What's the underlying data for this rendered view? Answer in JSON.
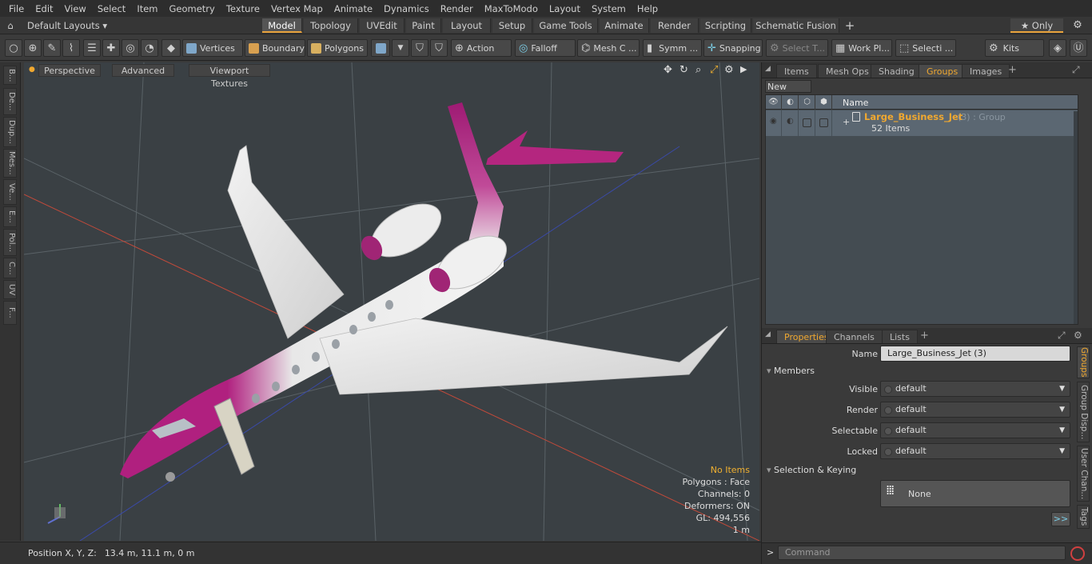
{
  "menubar": {
    "items": [
      "File",
      "Edit",
      "View",
      "Select",
      "Item",
      "Geometry",
      "Texture",
      "Vertex Map",
      "Animate",
      "Dynamics",
      "Render",
      "MaxToModo",
      "Layout",
      "System",
      "Help"
    ]
  },
  "layoutbar": {
    "layout_selector": "Default Layouts ▾",
    "tabs": [
      "Model",
      "Topology",
      "UVEdit",
      "Paint",
      "Layout",
      "Setup",
      "Game Tools",
      "Animate",
      "Render",
      "Scripting",
      "Schematic Fusion"
    ],
    "active_tab": "Model",
    "add_label": "+",
    "only_label": "★  Only",
    "gear_label": "⚙"
  },
  "toolbar": {
    "vertices": "Vertices",
    "boundary": "Boundary",
    "polygons": "Polygons",
    "action": "Action",
    "falloff": "Falloff",
    "mesh": "Mesh C ...",
    "symm": "Symm ...",
    "snapping": "Snapping",
    "select_t": "Select T...",
    "workplane": "Work Pl...",
    "selecti": "Selecti ...",
    "kits": "Kits"
  },
  "lefttabs": [
    "B...",
    "De...",
    "Dup...",
    "Mes...",
    "Ve...",
    "E...",
    "Pol...",
    "C...",
    "UV",
    "F..."
  ],
  "viewport": {
    "tabs": [
      "Perspective",
      "Advanced",
      "Viewport Textures"
    ],
    "info": {
      "no_items": "No Items",
      "polygons": "Polygons : Face",
      "channels": "Channels: 0",
      "deformers": "Deformers: ON",
      "gl": "GL: 494,556",
      "scale": "1 m"
    }
  },
  "statusbar": {
    "position_label": "Position X, Y, Z:",
    "position_value": "13.4 m, 11.1 m, 0 m"
  },
  "groups_panel": {
    "tabs": [
      "Items",
      "Mesh Ops",
      "Shading",
      "Groups",
      "Images"
    ],
    "active_tab": "Groups",
    "new_group": "New Group",
    "col_name": "Name",
    "row": {
      "name": "Large_Business_Jet",
      "suffix": "(3) : Group",
      "count": "52 Items"
    }
  },
  "properties": {
    "tabs": [
      "Properties",
      "Channels",
      "Lists"
    ],
    "active_tab": "Properties",
    "name_label": "Name",
    "name_value": "Large_Business_Jet (3)",
    "members_section": "Members",
    "visible_label": "Visible",
    "visible_value": "default",
    "render_label": "Render",
    "render_value": "default",
    "selectable_label": "Selectable",
    "selectable_value": "default",
    "locked_label": "Locked",
    "locked_value": "default",
    "selkey_section": "Selection & Keying",
    "none_label": "None",
    "more_label": ">>",
    "side_tabs": [
      "Groups",
      "Group Disp...",
      "User Chan...",
      "Tags"
    ]
  },
  "command": {
    "prompt": ">",
    "placeholder": "Command"
  },
  "colors": {
    "accent": "#e8a33c",
    "jet_pink": "#b0207f",
    "viewport_bg": "#3a4044"
  }
}
